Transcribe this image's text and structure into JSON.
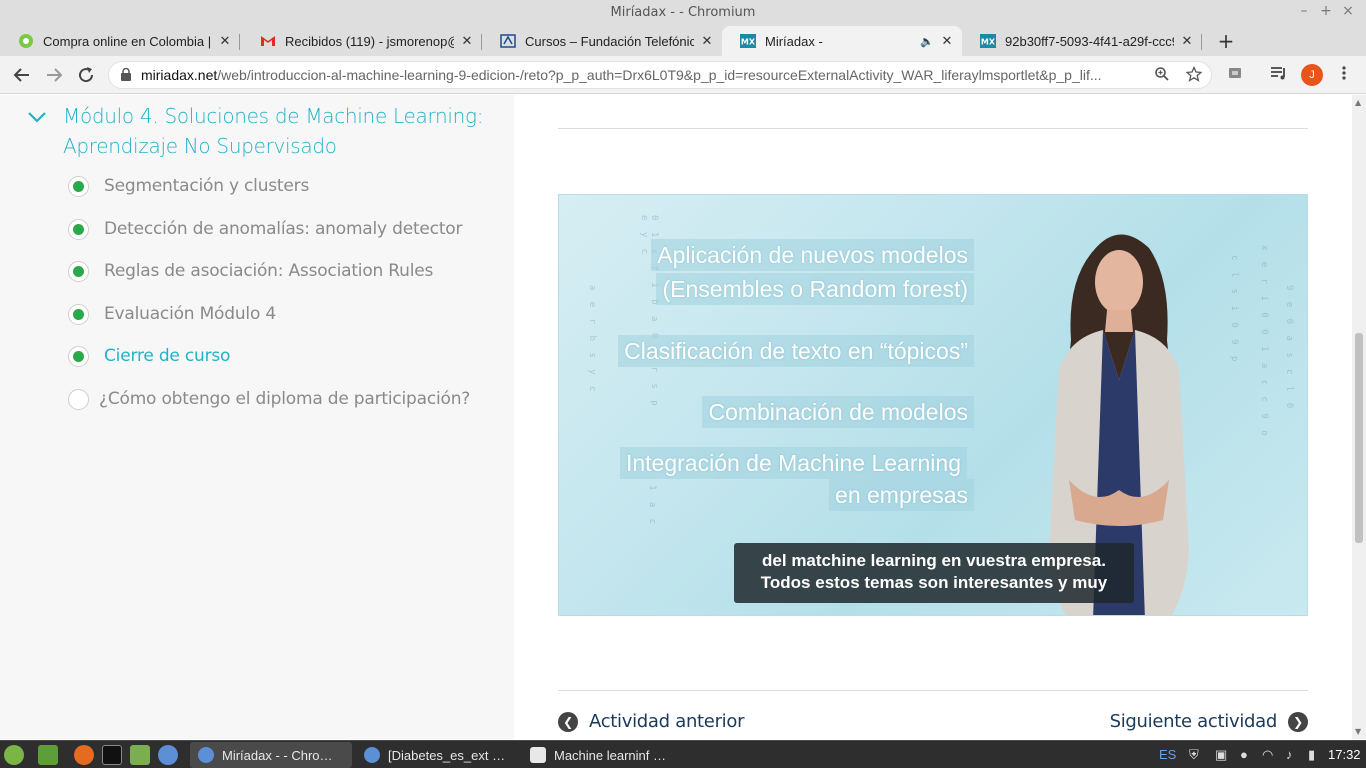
{
  "window": {
    "title": "Miríadax - - Chromium"
  },
  "tabs": [
    {
      "label": "Compra online en Colombia |",
      "icon": "mercadolibre-icon",
      "color": "#7ac943",
      "active": false
    },
    {
      "label": "Recibidos (119) - jsmorenop@",
      "icon": "gmail-icon",
      "color": "#d93025",
      "active": false
    },
    {
      "label": "Cursos – Fundación Telefónica",
      "icon": "telefonica-icon",
      "color": "#1b4b8f",
      "active": false
    },
    {
      "label": "Miríadax -",
      "icon": "miriadax-icon",
      "color": "#1e88a8",
      "active": true,
      "audio": true
    },
    {
      "label": "92b30ff7-5093-4f41-a29f-ccc9",
      "icon": "miriadax-icon",
      "color": "#1e88a8",
      "active": false
    }
  ],
  "toolbar": {
    "url_domain": "miriadax.net",
    "url_path": "/web/introduccion-al-machine-learning-9-edicion-/reto?p_p_auth=Drx6L0T9&p_p_id=resourceExternalActivity_WAR_liferaylmsportlet&p_p_lif...",
    "avatar_letter": "J",
    "avatar_color": "#e8541b"
  },
  "sidebar": {
    "module_title": "Módulo 4. Soluciones de Machine Learning: Aprendizaje No Supervisado",
    "lessons": [
      {
        "label": "Segmentación y clusters",
        "done": true,
        "current": false
      },
      {
        "label": "Detección de anomalías: anomaly detector",
        "done": true,
        "current": false
      },
      {
        "label": "Reglas de asociación: Association Rules",
        "done": true,
        "current": false
      },
      {
        "label": "Evaluación Módulo 4",
        "done": true,
        "current": false
      },
      {
        "label": "Cierre de curso",
        "done": true,
        "current": true
      },
      {
        "label": "¿Cómo obtengo el diploma de participación?",
        "done": false,
        "current": false
      }
    ]
  },
  "video": {
    "slide_lines": [
      "Aplicación de nuevos modelos",
      "(Ensembles o Random forest)",
      "Clasificación de texto en “tópicos”",
      "Combinación de modelos",
      "Integración de Machine Learning",
      "en empresas"
    ],
    "subtitle_line1": "del matchine learning en vuestra empresa.",
    "subtitle_line2": "Todos estos temas son interesantes y muy"
  },
  "navigation": {
    "prev_label": "Actividad anterior",
    "next_label": "Siguiente actividad"
  },
  "taskbar": {
    "tasks": [
      {
        "label": "Miríadax - - Chro…",
        "icon": "chromium-icon",
        "active": true
      },
      {
        "label": "[Diabetes_es_ext …",
        "icon": "chromium-icon",
        "active": false
      },
      {
        "label": "Machine learninf …",
        "icon": "document-icon",
        "active": false
      }
    ],
    "keyboard_layout": "ES",
    "clock": "17:32"
  },
  "colors": {
    "accent": "#22b2c8",
    "done": "#2aa84a",
    "nav_text": "#1a3a5a"
  }
}
